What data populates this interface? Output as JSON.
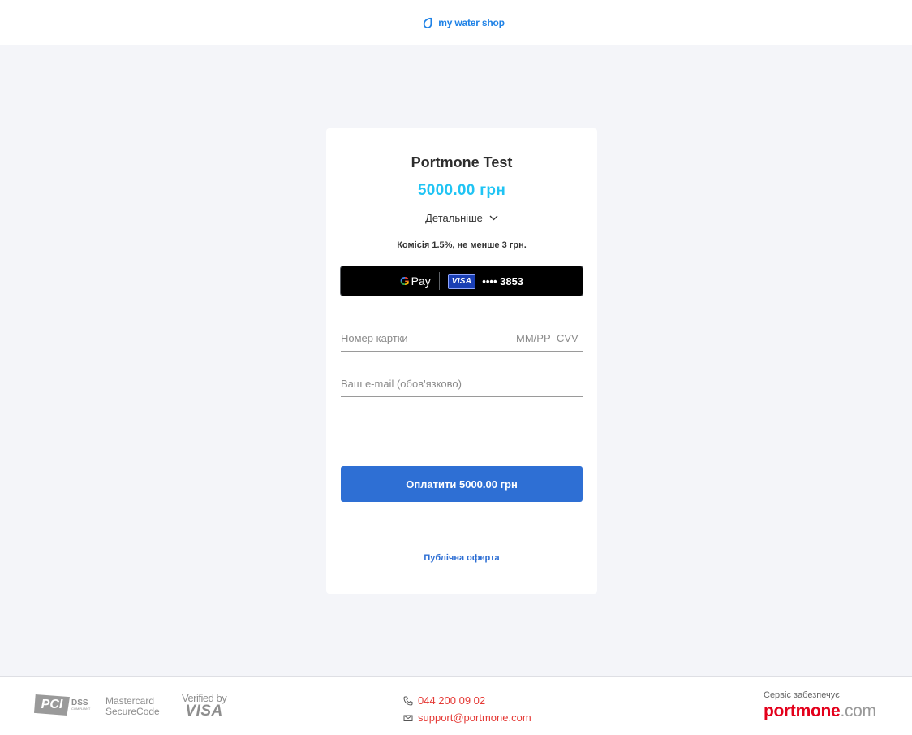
{
  "header": {
    "brand_name": "my water shop",
    "brand_icon": "water-drop-icon"
  },
  "payment": {
    "merchant": "Portmone Test",
    "amount": "5000.00 грн",
    "details_label": "Детальніше",
    "commission": "Комісія 1.5%, не менше 3 грн.",
    "gpay": {
      "label": "Pay",
      "card_brand": "VISA",
      "card_mask": "•••• 3853"
    },
    "card_number_placeholder": "Номер картки",
    "expiry_placeholder": "ММ/РР",
    "cvv_placeholder": "CVV",
    "email_placeholder": "Ваш e-mail (обов'язково)",
    "pay_button": "Оплатити 5000.00 грн",
    "offer_link": "Публічна оферта"
  },
  "footer": {
    "badges": {
      "pci_main": "PCI",
      "pci_dss": "DSS",
      "pci_sub": "COMPLIANT",
      "mastercard_line1": "Mastercard",
      "mastercard_line2": "SecureCode",
      "visa_line1": "Verified by",
      "visa_line2": "VISA"
    },
    "phone": "044 200 09 02",
    "email": "support@portmone.com",
    "powered_label": "Сервіс забезпечує",
    "logo_main": "portmone",
    "logo_suffix": ".com"
  },
  "colors": {
    "accent_blue": "#2e6fd4",
    "amount_cyan": "#20c4f4",
    "brand_red": "#e3001b",
    "background": "#f4f5f9"
  }
}
